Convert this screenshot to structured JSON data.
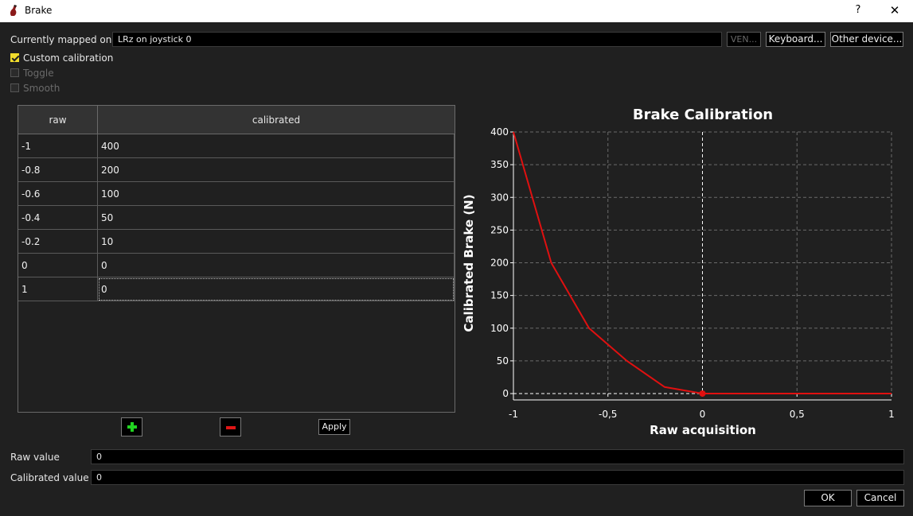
{
  "window": {
    "title": "Brake",
    "help_label": "?",
    "close_label": "✕"
  },
  "mapping": {
    "label": "Currently mapped on",
    "value": "LRz on joystick 0",
    "ven_label": "VEN...",
    "keyboard_label": "Keyboard...",
    "other_device_label": "Other device..."
  },
  "options": {
    "custom_calibration": {
      "label": "Custom calibration",
      "checked": true
    },
    "toggle": {
      "label": "Toggle",
      "checked": false
    },
    "smooth": {
      "label": "Smooth",
      "checked": false
    }
  },
  "table": {
    "headers": [
      "raw",
      "calibrated"
    ],
    "rows": [
      [
        "-1",
        "400"
      ],
      [
        "-0.8",
        "200"
      ],
      [
        "-0.6",
        "100"
      ],
      [
        "-0.4",
        "50"
      ],
      [
        "-0.2",
        "10"
      ],
      [
        "0",
        "0"
      ],
      [
        "1",
        "0"
      ]
    ]
  },
  "apply_label": "Apply",
  "raw_value": {
    "label": "Raw value",
    "value": "0"
  },
  "calibrated_value": {
    "label": "Calibrated value",
    "value": "0"
  },
  "ok_label": "OK",
  "cancel_label": "Cancel",
  "colors": {
    "series": "#e01010",
    "grid": "#6a6a6a",
    "accent_check": "#f1dc2c"
  },
  "chart_data": {
    "type": "line",
    "title": "Brake Calibration",
    "xlabel": "Raw acquisition",
    "ylabel": "Calibrated Brake (N)",
    "xlim": [
      -1,
      1
    ],
    "ylim": [
      0,
      400
    ],
    "xticks": [
      -1,
      -0.5,
      0,
      0.5,
      1
    ],
    "xtick_labels": [
      "-1",
      "-0,5",
      "0",
      "0,5",
      "1"
    ],
    "yticks": [
      0,
      50,
      100,
      150,
      200,
      250,
      300,
      350,
      400
    ],
    "ytick_labels": [
      "0",
      "50",
      "100",
      "150",
      "200",
      "250",
      "300",
      "350",
      "400"
    ],
    "grid": true,
    "series": [
      {
        "x": [
          -1,
          -0.8,
          -0.6,
          -0.4,
          -0.2,
          0,
          1
        ],
        "y": [
          400,
          200,
          100,
          50,
          10,
          0,
          0
        ]
      }
    ],
    "current_point": {
      "x": 0,
      "y": 0
    }
  }
}
